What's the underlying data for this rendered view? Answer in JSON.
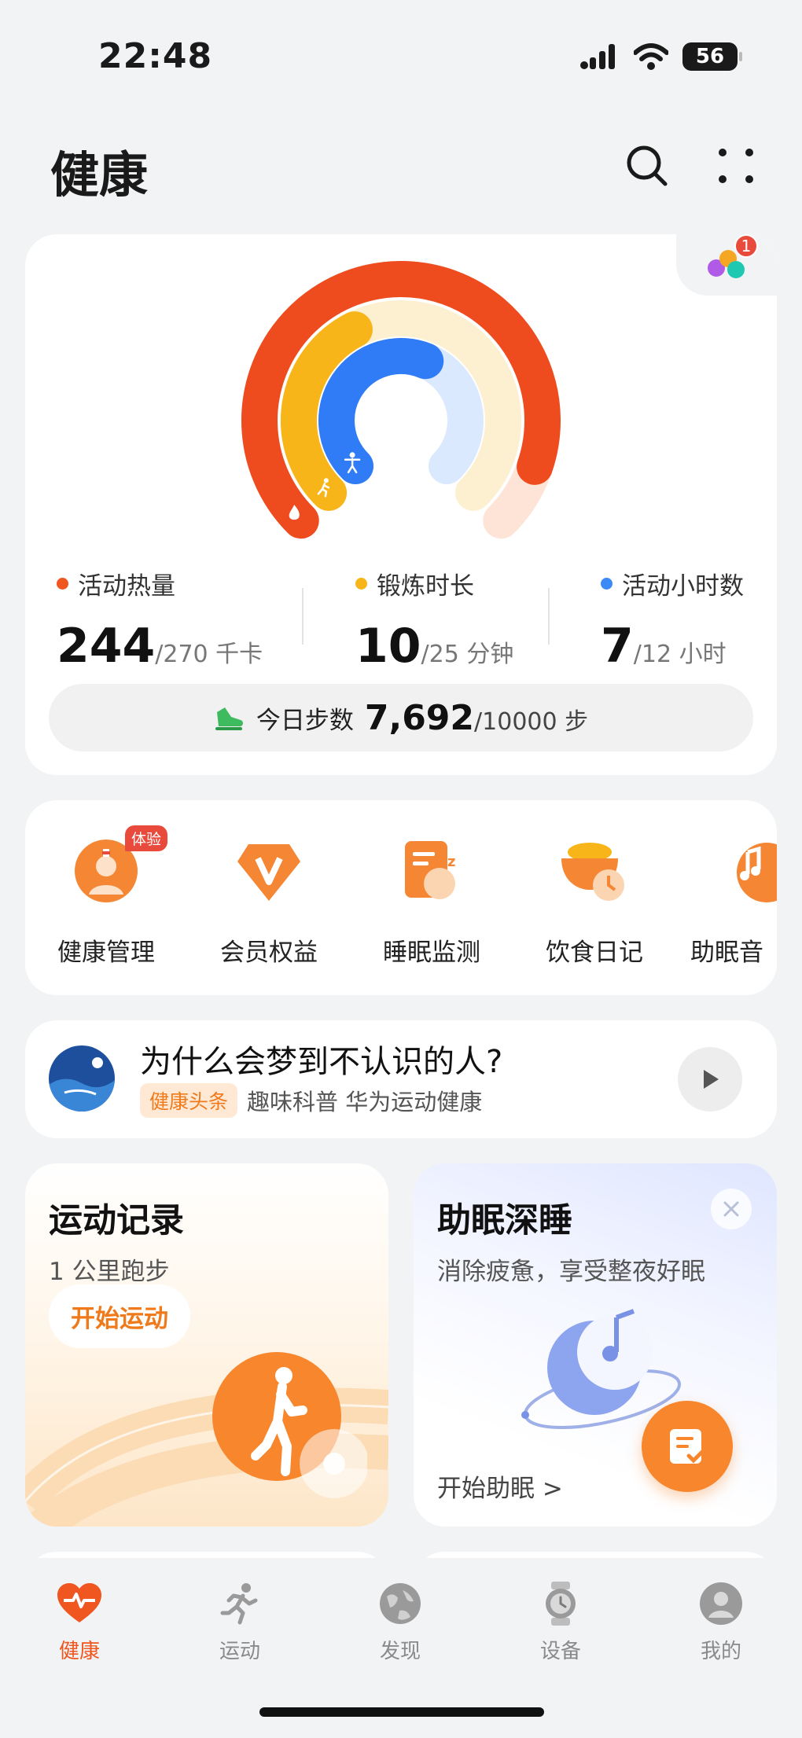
{
  "status_bar": {
    "time": "22:48",
    "battery": "56",
    "icons": [
      "signal-icon",
      "wifi-icon",
      "battery-icon"
    ]
  },
  "header": {
    "title": "健康",
    "icons": [
      "search-icon",
      "more-icon"
    ]
  },
  "activity": {
    "badge_count": "1",
    "stats": [
      {
        "label": "活动热量",
        "value": "244",
        "goal": "/270 千卡",
        "color": "#f0561f",
        "progress": 0.904
      },
      {
        "label": "锻炼时长",
        "value": "10",
        "goal": "/25 分钟",
        "color": "#f8b51a",
        "progress": 0.4
      },
      {
        "label": "活动小时数",
        "value": "7",
        "goal": "/12 小时",
        "color": "#3d8af7",
        "progress": 0.583
      }
    ],
    "steps": {
      "label": "今日步数",
      "value": "7,692",
      "goal": "/10000 步",
      "progress": 0.769
    }
  },
  "shortcuts": {
    "items": [
      {
        "label": "健康管理",
        "icon": "doctor-icon",
        "badge": "体验"
      },
      {
        "label": "会员权益",
        "icon": "vip-icon"
      },
      {
        "label": "睡眠监测",
        "icon": "sleep-monitor-icon"
      },
      {
        "label": "饮食日记",
        "icon": "diet-diary-icon"
      },
      {
        "label": "助眠音",
        "icon": "sleep-music-icon"
      }
    ]
  },
  "news": {
    "title": "为什么会梦到不认识的人?",
    "tag": "健康头条",
    "source": "趣味科普 华为运动健康"
  },
  "workout_card": {
    "title": "运动记录",
    "subtitle": "1 公里跑步",
    "button": "开始运动"
  },
  "sleep_card": {
    "title": "助眠深睡",
    "subtitle": "消除疲惫，享受整夜好眠",
    "link": "开始助眠 >"
  },
  "bottom_nav": {
    "items": [
      {
        "label": "健康",
        "icon": "heart-pulse-icon",
        "active": true
      },
      {
        "label": "运动",
        "icon": "running-icon",
        "active": false
      },
      {
        "label": "发现",
        "icon": "globe-icon",
        "active": false
      },
      {
        "label": "设备",
        "icon": "watch-icon",
        "active": false
      },
      {
        "label": "我的",
        "icon": "profile-icon",
        "active": false
      }
    ],
    "active_color": "#f0561f",
    "inactive_color": "#8a8a8a"
  }
}
